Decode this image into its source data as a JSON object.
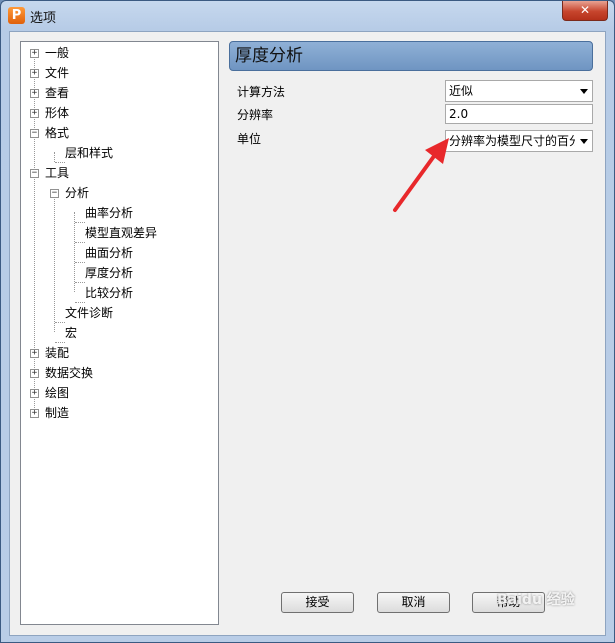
{
  "window": {
    "title": "选项",
    "app_icon_letter": "P",
    "close_glyph": "✕"
  },
  "tree": {
    "items": [
      {
        "label": "一般",
        "expander": "+"
      },
      {
        "label": "文件",
        "expander": "+"
      },
      {
        "label": "查看",
        "expander": "+"
      },
      {
        "label": "形体",
        "expander": "+"
      },
      {
        "label": "格式",
        "expander": "−"
      },
      {
        "label": "层和样式",
        "expander": ""
      },
      {
        "label": "工具",
        "expander": "−"
      },
      {
        "label": "分析",
        "expander": "−"
      },
      {
        "label": "曲率分析",
        "expander": ""
      },
      {
        "label": "模型直观差异",
        "expander": ""
      },
      {
        "label": "曲面分析",
        "expander": ""
      },
      {
        "label": "厚度分析",
        "expander": ""
      },
      {
        "label": "比较分析",
        "expander": ""
      },
      {
        "label": "文件诊断",
        "expander": ""
      },
      {
        "label": "宏",
        "expander": ""
      },
      {
        "label": "装配",
        "expander": "+"
      },
      {
        "label": "数据交换",
        "expander": "+"
      },
      {
        "label": "绘图",
        "expander": "+"
      },
      {
        "label": "制造",
        "expander": "+"
      }
    ]
  },
  "panel": {
    "title": "厚度分析",
    "fields": {
      "method": {
        "label": "计算方法",
        "value": "近似"
      },
      "resolution": {
        "label": "分辨率",
        "value": "2.0"
      },
      "unit": {
        "label": "单位",
        "value": "分辨率为模型尺寸的百分比"
      }
    }
  },
  "buttons": {
    "accept": "接受",
    "cancel": "取消",
    "help": "帮助"
  },
  "watermark": "Baidu 经验",
  "colors": {
    "annotation_arrow": "#e8282b",
    "panel_header": "#7fa3cd"
  }
}
